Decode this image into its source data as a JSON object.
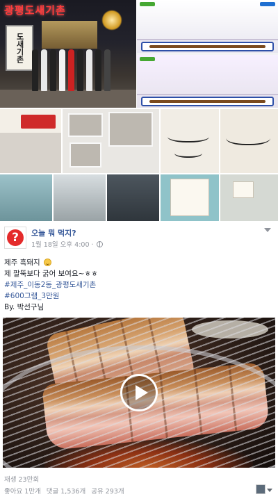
{
  "collage": {
    "restaurant_sign": "광평도새기촌",
    "signboard": "도새기촌"
  },
  "post": {
    "page_name": "오늘 뭐 먹지?",
    "avatar_symbol": "?",
    "timestamp": "1월 18일 오후 4:00 · ",
    "privacy_icon": "globe-icon",
    "options_icon": "chevron-down-icon",
    "lines": {
      "l1": "제주 흑돼지",
      "l2": "제 팔뚝보다 굵어 보여요~ㅎㅎ",
      "l3": "#제주_이동2동_광평도새기촌",
      "l4": "#600그램_3만원",
      "l5": "By. 박선구님"
    },
    "video": {
      "play_icon": "play-icon"
    },
    "views": "재생 23만회",
    "stats": {
      "likes": "좋아요 1만개",
      "comments": "댓글 1,536개",
      "shares": "공유 293개"
    }
  },
  "colors": {
    "link": "#365899",
    "meta": "#90949c",
    "sign_red": "#ff3b3b",
    "avatar_red": "#e42b2b"
  }
}
